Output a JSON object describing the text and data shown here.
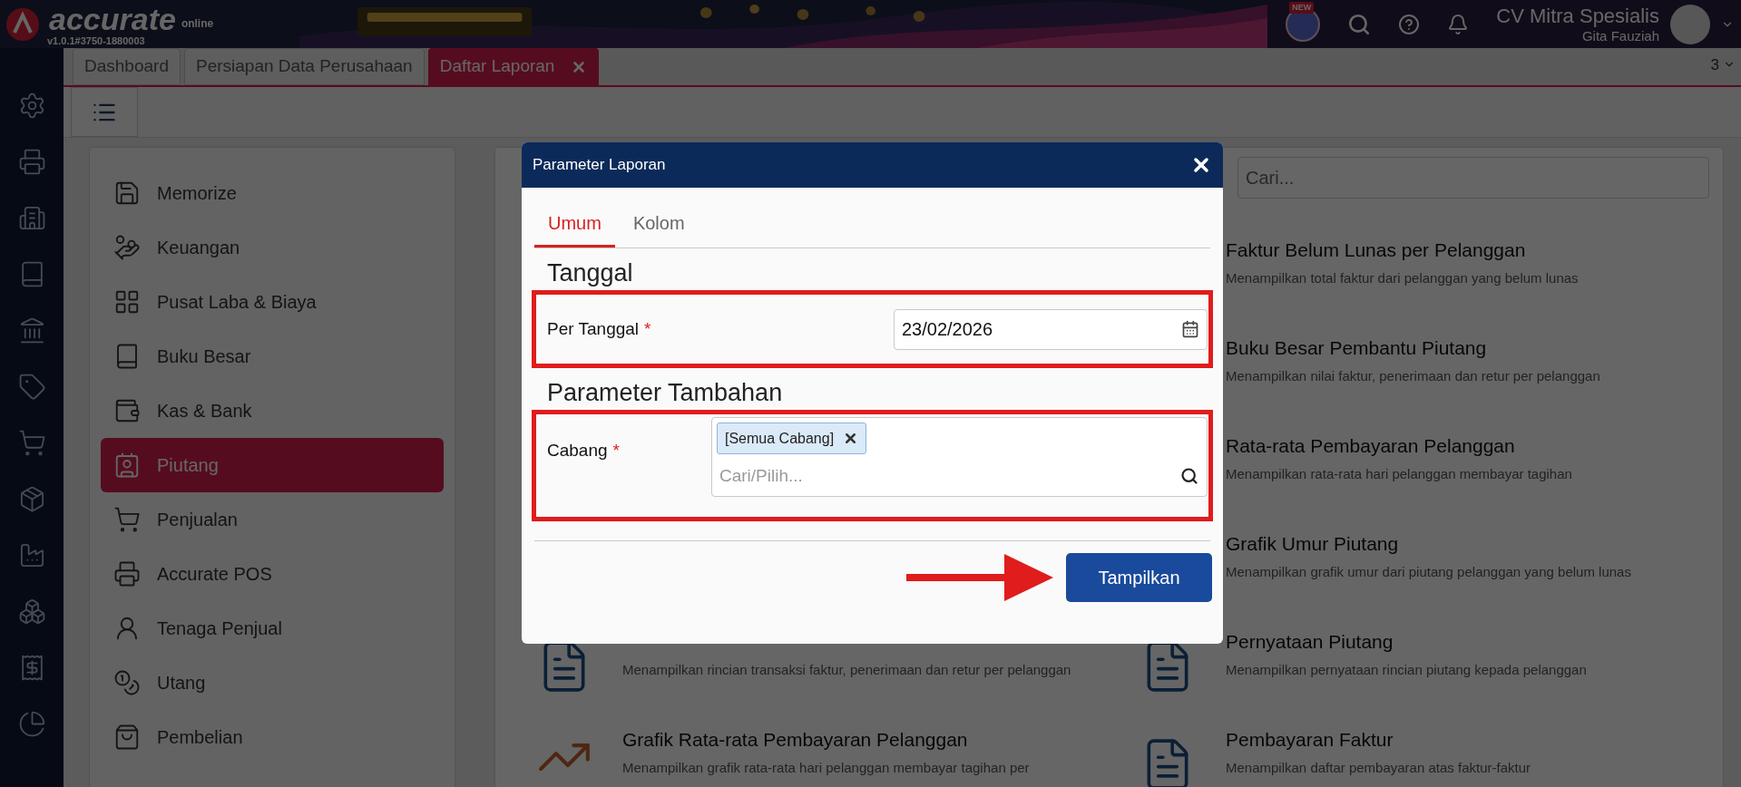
{
  "header": {
    "logo": "accurate",
    "logo_sub": "online",
    "version": "v1.0.1#3750-1880003",
    "badge": "NEW",
    "company": "CV Mitra Spesialis",
    "user": "Gita Fauziah"
  },
  "tabs": [
    {
      "label": "Dashboard",
      "selected": false,
      "closable": false
    },
    {
      "label": "Persiapan Data Perusahaan",
      "selected": false,
      "closable": false
    },
    {
      "label": "Daftar Laporan",
      "selected": true,
      "closable": true
    }
  ],
  "tab_count": "3",
  "menu": [
    {
      "label": "Memorize",
      "selected": false
    },
    {
      "label": "Keuangan",
      "selected": false
    },
    {
      "label": "Pusat Laba & Biaya",
      "selected": false
    },
    {
      "label": "Buku Besar",
      "selected": false
    },
    {
      "label": "Kas & Bank",
      "selected": false
    },
    {
      "label": "Piutang",
      "selected": true
    },
    {
      "label": "Penjualan",
      "selected": false
    },
    {
      "label": "Accurate POS",
      "selected": false
    },
    {
      "label": "Tenaga Penjual",
      "selected": false
    },
    {
      "label": "Utang",
      "selected": false
    },
    {
      "label": "Pembelian",
      "selected": false
    }
  ],
  "report_search": {
    "placeholder": "Cari..."
  },
  "report_rows": [
    {
      "right": {
        "title": "Faktur Belum Lunas per Pelanggan",
        "description": "Menampilkan total faktur dari pelanggan yang belum lunas"
      }
    },
    {
      "right": {
        "title": "Buku Besar Pembantu Piutang",
        "description": "Menampilkan nilai faktur, penerimaan dan retur per pelanggan"
      }
    },
    {
      "right": {
        "title": "Rata-rata Pembayaran Pelanggan",
        "description": "Menampilkan rata-rata hari pelanggan membayar tagihan"
      }
    },
    {
      "right": {
        "title": "Grafik Umur Piutang",
        "description": "Menampilkan grafik umur dari piutang pelanggan yang belum lunas"
      }
    },
    {
      "left": {
        "kind": "document",
        "description": "Menampilkan rincian transaksi faktur, penerimaan dan retur per pelanggan"
      },
      "right": {
        "kind": "document",
        "title": "Pernyataan Piutang",
        "description": "Menampilkan pernyataan rincian piutang kepada pelanggan"
      }
    },
    {
      "left": {
        "kind": "chart",
        "title": "Grafik Rata-rata Pembayaran Pelanggan",
        "description": "Menampilkan grafik rata-rata hari pelanggan membayar tagihan per"
      },
      "right": {
        "kind": "document",
        "title": "Pembayaran Faktur",
        "description": "Menampilkan daftar pembayaran atas faktur-faktur"
      }
    }
  ],
  "dialog": {
    "title": "Parameter Laporan",
    "tabs": [
      {
        "label": "Umum",
        "selected": true
      },
      {
        "label": "Kolom",
        "selected": false
      }
    ],
    "sections": [
      {
        "heading": "Tanggal",
        "fields": [
          {
            "kind": "date",
            "label": "Per Tanggal",
            "required_mark": "*",
            "highlighted": true,
            "value": "23/02/2026"
          }
        ]
      },
      {
        "heading": "Parameter Tambahan",
        "fields": [
          {
            "kind": "multiselect",
            "label": "Cabang",
            "required_mark": "*",
            "highlighted": true,
            "chips": [
              "[Semua Cabang]"
            ],
            "placeholder": "Cari/Pilih..."
          }
        ]
      }
    ],
    "submit": "Tampilkan",
    "submit_arrow": true
  }
}
